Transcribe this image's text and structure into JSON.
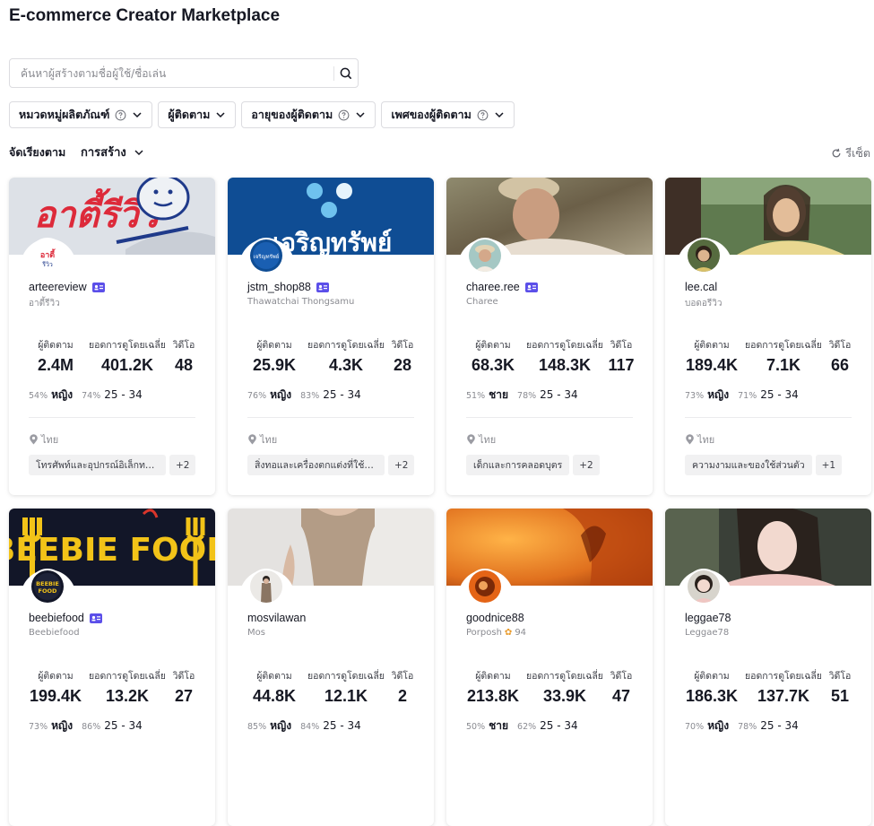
{
  "page": {
    "title": "E-commerce Creator Marketplace"
  },
  "search": {
    "placeholder": "ค้นหาผู้สร้างตามชื่อผู้ใช้/ชื่อเล่น"
  },
  "filters": [
    {
      "label": "หมวดหมู่ผลิตภัณฑ์",
      "has_help": true
    },
    {
      "label": "ผู้ติดตาม",
      "has_help": false
    },
    {
      "label": "อายุของผู้ติดตาม",
      "has_help": true
    },
    {
      "label": "เพศของผู้ติดตาม",
      "has_help": true
    }
  ],
  "sort": {
    "label": "จัดเรียงตาม",
    "value": "การสร้าง"
  },
  "reset": {
    "label": "รีเซ็ต"
  },
  "stat_labels": {
    "followers": "ผู้ติดตาม",
    "avg_views": "ยอดการดูโดยเฉลี่ย",
    "videos": "วิดีโอ"
  },
  "creators": [
    {
      "username": "arteereview",
      "nickname": "อาตี้รีวิว",
      "verified": true,
      "followers": "2.4M",
      "avg_views": "401.2K",
      "videos": "48",
      "gender_pct": "54%",
      "gender": "หญิง",
      "age_pct": "74%",
      "age": "25 - 34",
      "location": "ไทย",
      "tag": "โทรศัพท์และอุปกรณ์อิเล็กทรอนิกส์",
      "more": "+2"
    },
    {
      "username": "jstm_shop88",
      "nickname": "Thawatchai Thongsamu",
      "verified": true,
      "followers": "25.9K",
      "avg_views": "4.3K",
      "videos": "28",
      "gender_pct": "76%",
      "gender": "หญิง",
      "age_pct": "83%",
      "age": "25 - 34",
      "location": "ไทย",
      "tag": "สิ่งทอและเครื่องตกแต่งที่ใช้ในบ้าน",
      "more": "+2"
    },
    {
      "username": "charee.ree",
      "nickname": "Charee",
      "verified": true,
      "followers": "68.3K",
      "avg_views": "148.3K",
      "videos": "117",
      "gender_pct": "51%",
      "gender": "ชาย",
      "age_pct": "78%",
      "age": "25 - 34",
      "location": "ไทย",
      "tag": "เด็กและการคลอดบุตร",
      "more": "+2"
    },
    {
      "username": "lee.cal",
      "nickname": "บอดอรีวิว",
      "verified": false,
      "followers": "189.4K",
      "avg_views": "7.1K",
      "videos": "66",
      "gender_pct": "73%",
      "gender": "หญิง",
      "age_pct": "71%",
      "age": "25 - 34",
      "location": "ไทย",
      "tag": "ความงามและของใช้ส่วนตัว",
      "more": "+1"
    },
    {
      "username": "beebiefood",
      "nickname": "Beebiefood",
      "verified": true,
      "followers": "199.4K",
      "avg_views": "13.2K",
      "videos": "27",
      "gender_pct": "73%",
      "gender": "หญิง",
      "age_pct": "86%",
      "age": "25 - 34"
    },
    {
      "username": "mosvilawan",
      "nickname": "Mos",
      "verified": false,
      "followers": "44.8K",
      "avg_views": "12.1K",
      "videos": "2",
      "gender_pct": "85%",
      "gender": "หญิง",
      "age_pct": "84%",
      "age": "25 - 34"
    },
    {
      "username": "goodnice88",
      "nickname": "Porposh",
      "nickname_extra": "94",
      "verified": false,
      "followers": "213.8K",
      "avg_views": "33.9K",
      "videos": "47",
      "gender_pct": "50%",
      "gender": "ชาย",
      "age_pct": "62%",
      "age": "25 - 34"
    },
    {
      "username": "leggae78",
      "nickname": "Leggae78",
      "verified": false,
      "followers": "186.3K",
      "avg_views": "137.7K",
      "videos": "51",
      "gender_pct": "70%",
      "gender": "หญิง",
      "age_pct": "78%",
      "age": "25 - 34"
    }
  ],
  "cover_art_text": {
    "c1": "อาตี้รีวิว",
    "c2": "เจริญทรัพย์",
    "c5": "BEEBIE FOOD"
  },
  "colors": {
    "accent_badge": "#5b4fe9",
    "text_primary": "#161823",
    "text_muted": "#8a8b91",
    "border": "#dcdce0"
  }
}
